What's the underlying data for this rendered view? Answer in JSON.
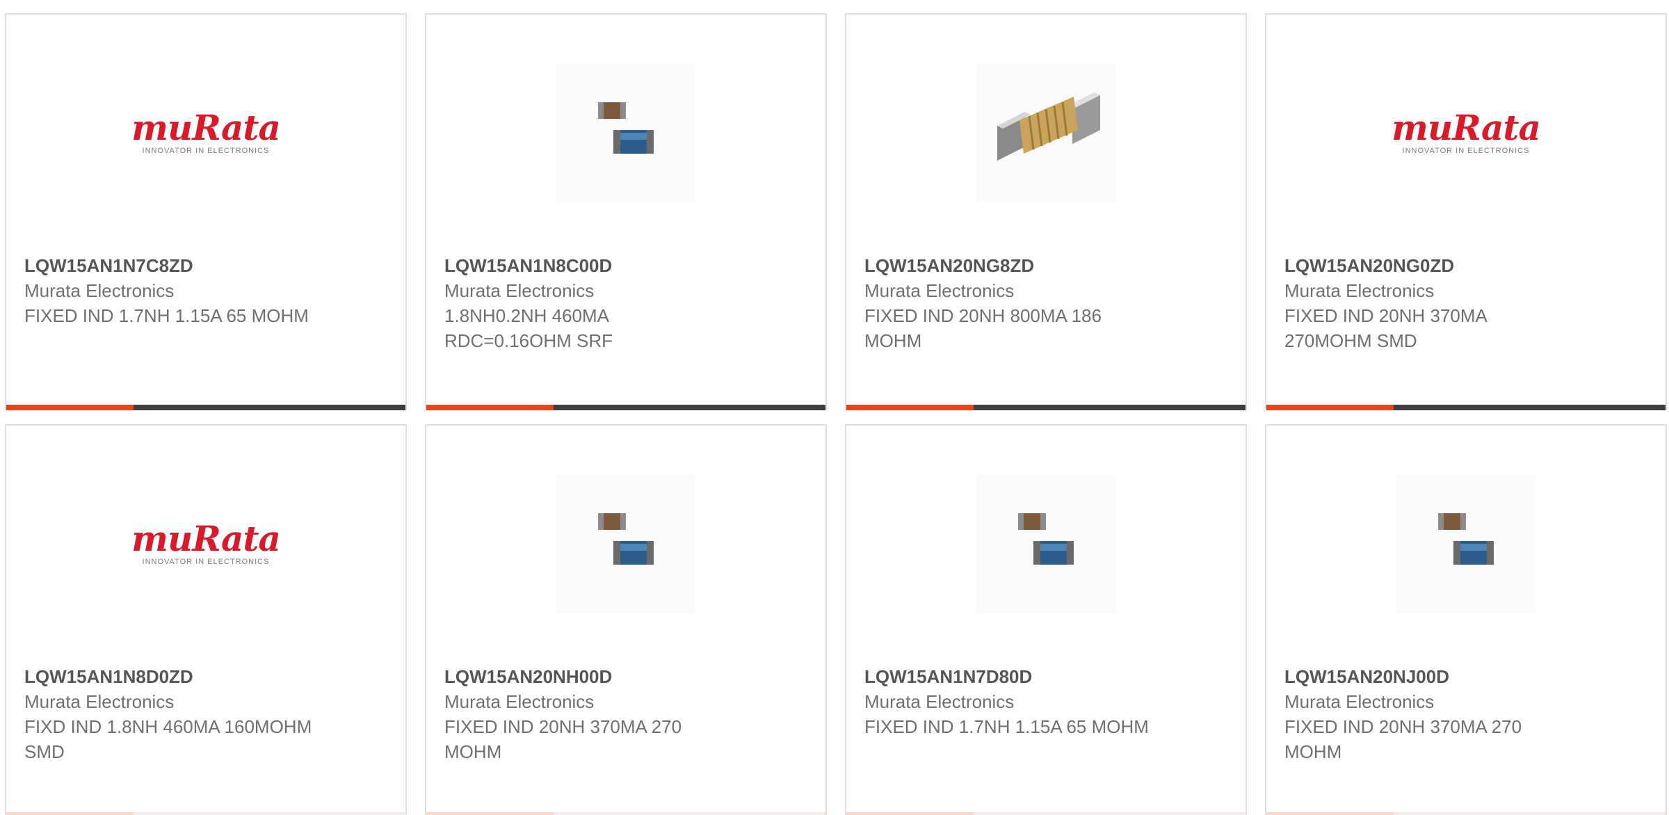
{
  "colors": {
    "accent": "#e8411b",
    "bar_dark": "#3d3d3d",
    "logo_red": "#d81b2a",
    "border": "#dedede"
  },
  "cards": [
    {
      "part": "LQW15AN1N7C8ZD",
      "mfr": "Murata Electronics",
      "desc": "FIXED IND 1.7NH 1.15A 65 MOHM",
      "image": "murata-logo"
    },
    {
      "part": "LQW15AN1N8C00D",
      "mfr": "Murata Electronics",
      "desc": "1.8NH0.2NH 460MA RDC=0.16OHM SRF",
      "image": "chip-inductor-pair"
    },
    {
      "part": "LQW15AN20NG8ZD",
      "mfr": "Murata Electronics",
      "desc": "FIXED IND 20NH 800MA 186 MOHM",
      "image": "wirewound-inductor"
    },
    {
      "part": "LQW15AN20NG0ZD",
      "mfr": "Murata Electronics",
      "desc": "FIXED IND 20NH 370MA 270MOHM SMD",
      "image": "murata-logo"
    },
    {
      "part": "LQW15AN1N8D0ZD",
      "mfr": "Murata Electronics",
      "desc": "FIXD IND 1.8NH 460MA 160MOHM SMD",
      "image": "murata-logo"
    },
    {
      "part": "LQW15AN20NH00D",
      "mfr": "Murata Electronics",
      "desc": "FIXED IND 20NH 370MA 270 MOHM",
      "image": "chip-inductor-pair"
    },
    {
      "part": "LQW15AN1N7D80D",
      "mfr": "Murata Electronics",
      "desc": "FIXED IND 1.7NH 1.15A 65 MOHM",
      "image": "chip-inductor-pair"
    },
    {
      "part": "LQW15AN20NJ00D",
      "mfr": "Murata Electronics",
      "desc": "FIXED IND 20NH 370MA 270 MOHM",
      "image": "chip-inductor-pair"
    }
  ],
  "logo": {
    "word": "muRata",
    "tagline": "INNOVATOR IN ELECTRONICS"
  }
}
